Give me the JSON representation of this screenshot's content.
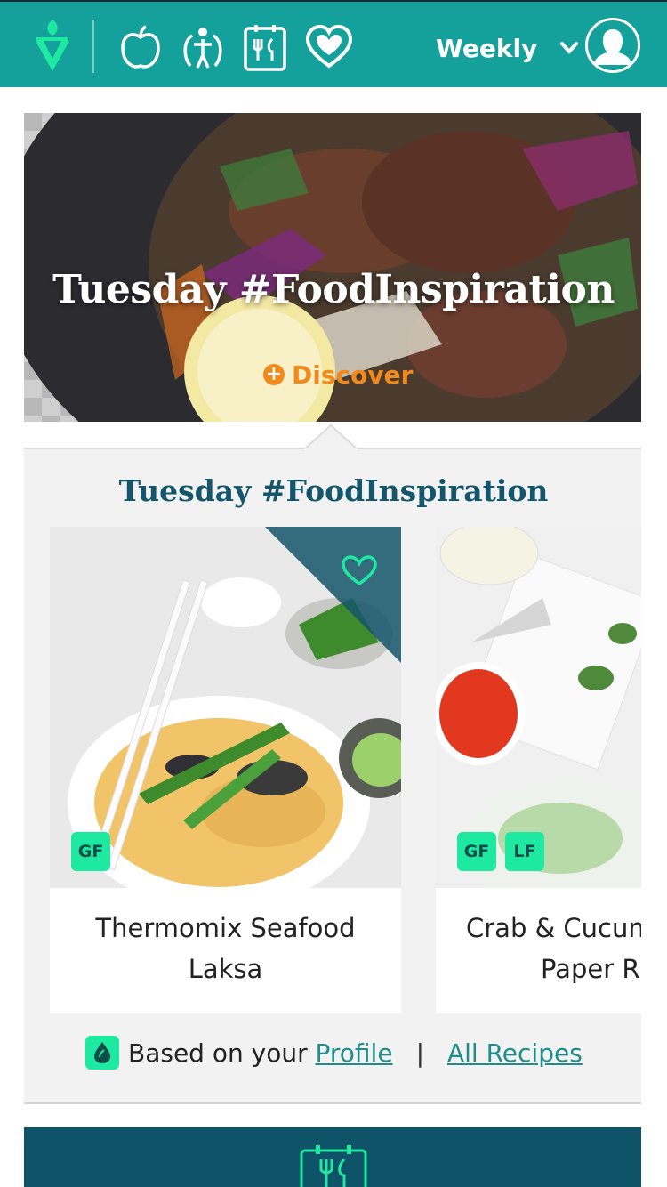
{
  "topbar": {
    "logo_icon": "v-sprout-logo-icon",
    "nav_icons": [
      "apple-icon",
      "fitness-person-icon",
      "meal-cutlery-icon",
      "heart-icon"
    ],
    "period_label": "Weekly",
    "period_icon": "chevron-down-icon",
    "profile_icon": "user-avatar-icon",
    "bg_color": "#14a19b"
  },
  "hero": {
    "title": "Tuesday #FoodInspiration",
    "discover_label": "Discover",
    "discover_color": "#f08a1d"
  },
  "section": {
    "title": "Tuesday #FoodInspiration"
  },
  "recipes": [
    {
      "name_line1": "Thermomix Seafood",
      "name_line2": "Laksa",
      "badges": [
        "GF"
      ],
      "favorite_icon": "heart-outline-icon"
    },
    {
      "name_line1": "Crab & Cucun",
      "name_line2": "Paper R",
      "badges": [
        "GF",
        "LF"
      ]
    }
  ],
  "footer": {
    "prefix": "Based on your",
    "profile_link": "Profile",
    "separator": "|",
    "all_recipes_link": "All Recipes",
    "icon": "drop-icon"
  },
  "colors": {
    "accent": "#14a19b",
    "badge": "#1de9a0",
    "title": "#14566b",
    "footer_band": "#0e5367"
  }
}
